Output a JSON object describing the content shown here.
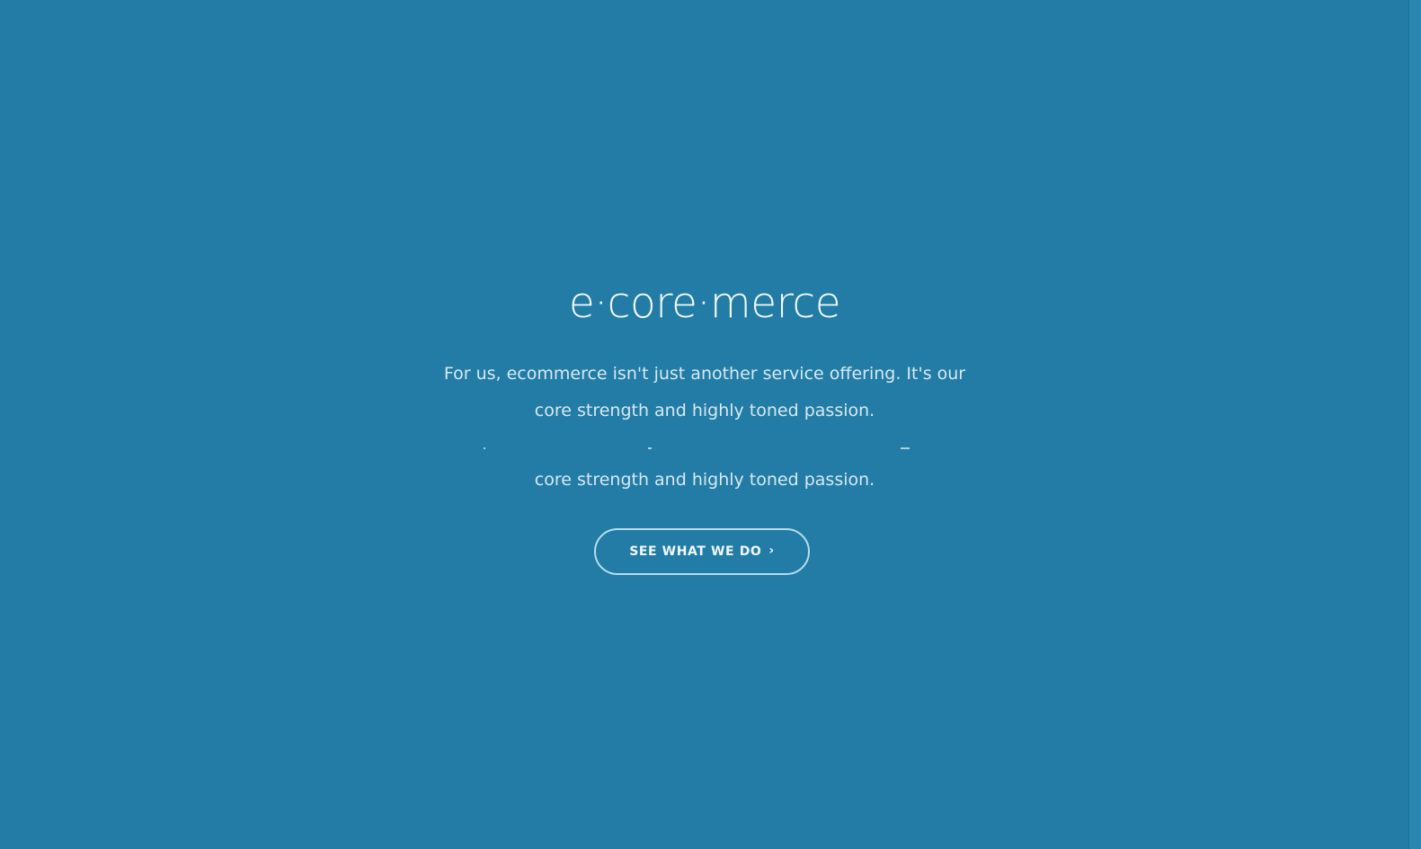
{
  "hero": {
    "title": "e·core·merce",
    "description_lines": [
      "For us, ecommerce isn't just another service offering. It's our",
      "core strength and highly toned passion.",
      "core strength and highly toned passion."
    ],
    "cta": {
      "label": "SEE WHAT WE DO",
      "arrow_icon": "chevron-right-icon",
      "arrow_glyph": "›"
    }
  },
  "colors": {
    "background": "#227ca5",
    "text": "#e7f3f8",
    "button_border": "#b8dcec"
  }
}
